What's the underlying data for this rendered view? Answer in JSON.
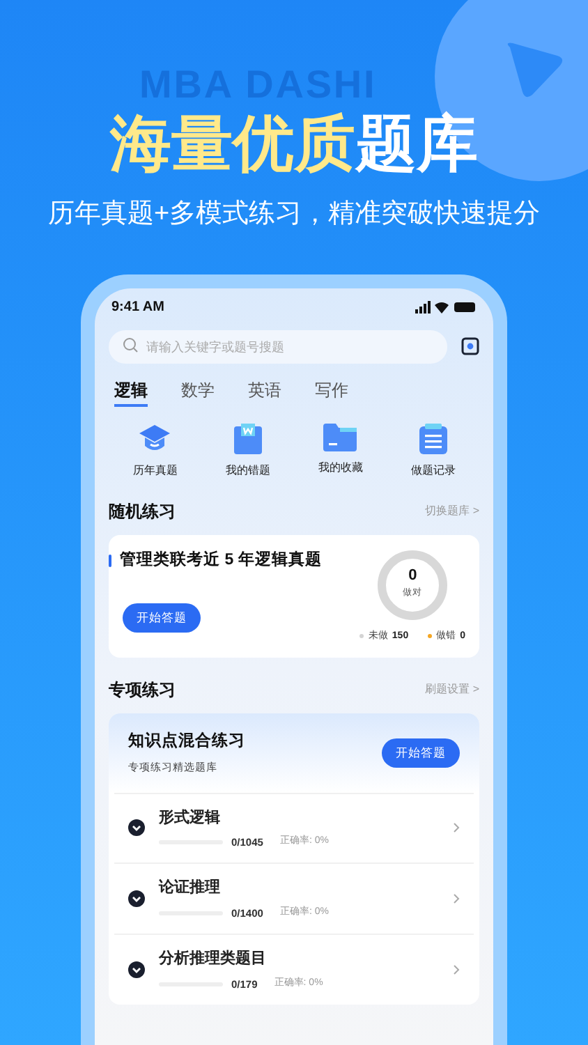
{
  "backdrop_text": "MBA DASHI",
  "headline": {
    "highlight": "海量优质",
    "rest": "题库"
  },
  "subtitle": "历年真题+多模式练习，精准突破快速提分",
  "status_bar": {
    "time": "9:41 AM"
  },
  "search": {
    "placeholder": "请输入关键字或题号搜题"
  },
  "tabs": [
    {
      "label": "逻辑",
      "selected": true
    },
    {
      "label": "数学",
      "selected": false
    },
    {
      "label": "英语",
      "selected": false
    },
    {
      "label": "写作",
      "selected": false
    }
  ],
  "shortcuts": [
    {
      "label": "历年真题",
      "kind": "cap"
    },
    {
      "label": "我的错题",
      "kind": "book"
    },
    {
      "label": "我的收藏",
      "kind": "folder"
    },
    {
      "label": "做题记录",
      "kind": "list"
    }
  ],
  "random_practice": {
    "title": "随机练习",
    "link": "切换题库 >",
    "card": {
      "title": "管理类联考近 5 年逻辑真题",
      "button": "开始答题",
      "count": "0",
      "count_label": "做对",
      "level": 0,
      "stats": [
        {
          "label": "未做",
          "value": "150",
          "color": "#d4d4d4"
        },
        {
          "label": "做错",
          "value": "0",
          "color": "#f5a623"
        }
      ]
    }
  },
  "special_practice": {
    "title": "专项练习",
    "link": "刷题设置 >",
    "mixed": {
      "title": "知识点混合练习",
      "subtitle": "专项练习精选题库",
      "button": "开始答题"
    },
    "topics": [
      {
        "name": "形式逻辑",
        "progress": "0/1045",
        "accuracy": "正确率: 0%",
        "level": 0
      },
      {
        "name": "论证推理",
        "progress": "0/1400",
        "accuracy": "正确率: 0%",
        "level": 0
      },
      {
        "name": "分析推理类题目",
        "progress": "0/179",
        "accuracy": "正确率: 0%",
        "level": 0
      }
    ]
  }
}
